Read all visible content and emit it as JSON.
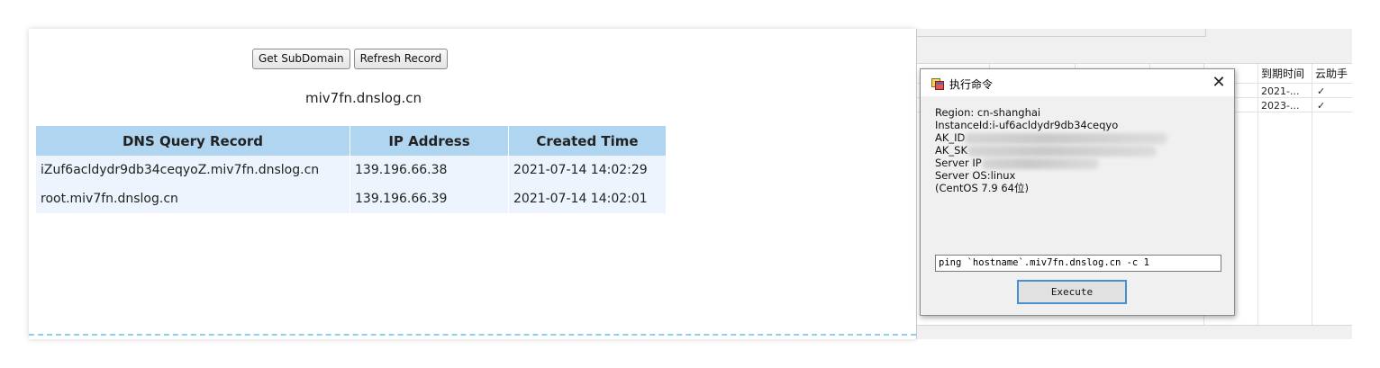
{
  "web": {
    "buttons": {
      "get_subdomain": "Get SubDomain",
      "refresh_record": "Refresh Record"
    },
    "domain": "miv7fn.dnslog.cn",
    "table": {
      "headers": [
        "DNS Query Record",
        "IP Address",
        "Created Time"
      ],
      "rows": [
        [
          "iZuf6acldydr9db34ceqyoZ.miv7fn.dnslog.cn",
          "139.196.66.38",
          "2021-07-14 14:02:29"
        ],
        [
          "root.miv7fn.dnslog.cn",
          "139.196.66.39",
          "2021-07-14 14:02:01"
        ]
      ]
    }
  },
  "grid": {
    "headers": [
      "到期时间",
      "云助手"
    ],
    "rows": [
      {
        "expire": "2021-...",
        "assistant": "✓"
      },
      {
        "expire": "2023-...",
        "assistant": "✓"
      }
    ]
  },
  "dialog": {
    "title": "执行命令",
    "close": "✕",
    "info": {
      "region": "Region: cn-shanghai",
      "instance": "InstanceId:i-uf6acldydr9db34ceqyo",
      "ak_id_label": "AK_ID",
      "ak_sk_label": "AK_SK",
      "server_ip_label": "Server IP",
      "server_os": "Server OS:linux",
      "os_version": "(CentOS  7.9 64位)"
    },
    "command": "ping `hostname`.miv7fn.dnslog.cn -c 1",
    "execute_label": "Execute"
  },
  "colors": {
    "table_header": "#b0d5f0",
    "table_row": "#edf4fe",
    "execute_border": "#4a8fd0",
    "dashed_line": "#8fd0ee"
  }
}
